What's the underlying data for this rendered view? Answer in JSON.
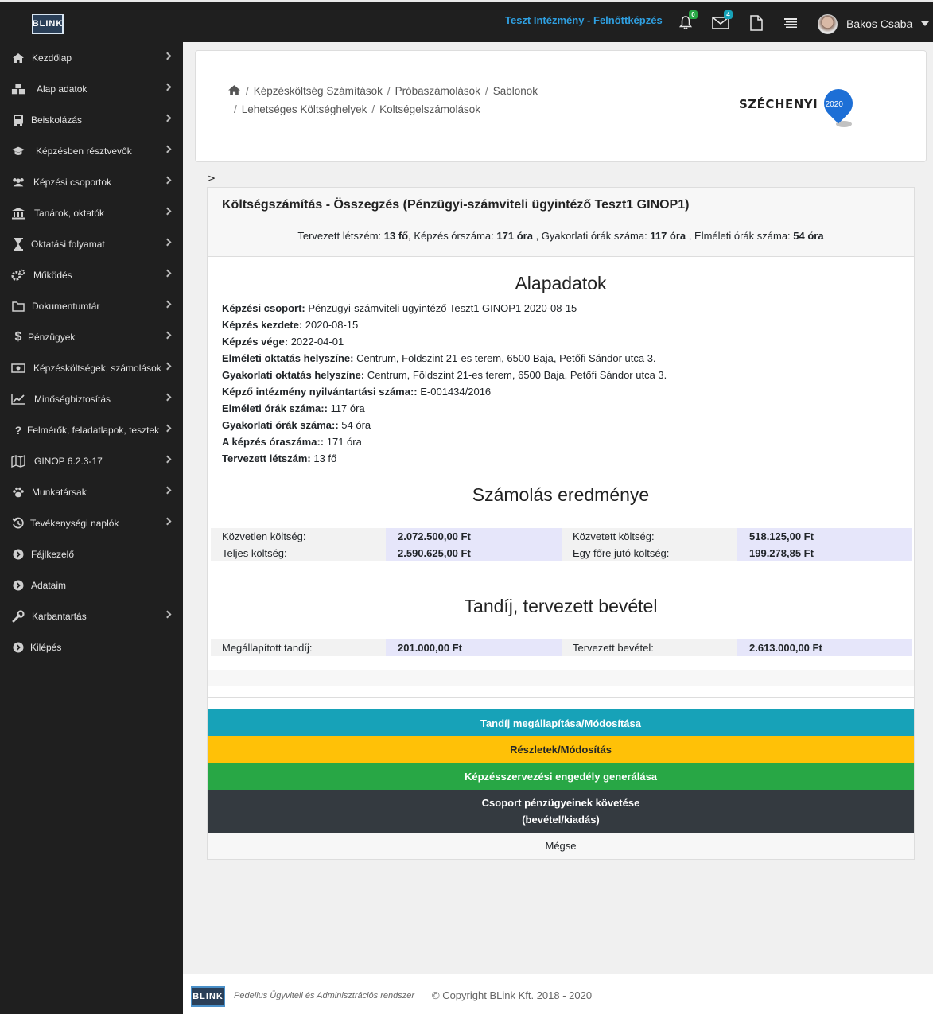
{
  "topbar": {
    "logo": "BLINK",
    "institution": "Teszt Intézmény - Felnőttképzés",
    "notifications_count": "0",
    "messages_count": "4",
    "user_name": "Bakos Csaba"
  },
  "sidebar": {
    "items": [
      {
        "label": "Kezdőlap",
        "icon": "home-icon"
      },
      {
        "label": "Alap adatok",
        "icon": "cubes-icon"
      },
      {
        "label": "Beiskolázás",
        "icon": "bus-icon"
      },
      {
        "label": "Képzésben résztvevők",
        "icon": "graduation-cap-icon"
      },
      {
        "label": "Képzési csoportok",
        "icon": "users-icon"
      },
      {
        "label": "Tanárok, oktatók",
        "icon": "institution-icon"
      },
      {
        "label": "Oktatási folyamat",
        "icon": "hourglass-icon"
      },
      {
        "label": "Működés",
        "icon": "gears-icon"
      },
      {
        "label": "Dokumentumtár",
        "icon": "folder-icon"
      },
      {
        "label": "Pénzügyek",
        "icon": "dollar-icon"
      },
      {
        "label": "Képzésköltségek, számolások",
        "icon": "money-icon"
      },
      {
        "label": "Minőségbiztosítás",
        "icon": "line-chart-icon"
      },
      {
        "label": "Felmérők, feladatlapok, tesztek",
        "icon": "question-icon"
      },
      {
        "label": "GINOP 6.2.3-17",
        "icon": "map-icon"
      },
      {
        "label": "Munkatársak",
        "icon": "paw-icon"
      },
      {
        "label": "Tevékenységi naplók",
        "icon": "history-icon"
      },
      {
        "label": "Fájlkezelő",
        "icon": "circle-arrow-icon"
      },
      {
        "label": "Adataim",
        "icon": "circle-arrow-icon"
      },
      {
        "label": "Karbantartás",
        "icon": "wrench-icon"
      },
      {
        "label": "Kilépés",
        "icon": "circle-arrow-icon"
      }
    ]
  },
  "breadcrumb": {
    "items": [
      "Képzésköltség Számítások",
      "Próbaszámolások",
      "Sablonok",
      "Lehetséges Költséghelyek",
      "Koltségelszámolások"
    ],
    "partner_logo_text": "SZÉCHENYI",
    "partner_logo_badge": "2020"
  },
  "gt_marker": ">",
  "card": {
    "title": "Költségszámítás - Összegzés (Pénzügyi-számviteli ügyintéző Teszt1 GINOP1)",
    "summary": {
      "planned_label": "Tervezett létszém:",
      "planned_value": "13 fő",
      "hours_label": ", Képzés órszáma:",
      "hours_value": "171 óra",
      "practice_label": ", Gyakorlati órák száma:",
      "practice_value": "117 óra",
      "theory_label": ", Elméleti órák száma:",
      "theory_value": "54 óra"
    },
    "basic_title": "Alapadatok",
    "details": [
      {
        "label": "Képzési csoport:",
        "value": " Pénzügyi-számviteli ügyintéző Teszt1 GINOP1 2020-08-15"
      },
      {
        "label": "Képzés kezdete:",
        "value": " 2020-08-15"
      },
      {
        "label": "Képzés vége:",
        "value": " 2022-04-01"
      },
      {
        "label": "Elméleti oktatás helyszíne:",
        "value": " Centrum, Földszint 21-es terem, 6500 Baja, Petőfi Sándor utca 3."
      },
      {
        "label": "Gyakorlati oktatás helyszíne:",
        "value": " Centrum, Földszint 21-es terem, 6500 Baja, Petőfi Sándor utca 3."
      },
      {
        "label": "Képző intézmény nyilvántartási száma::",
        "value": " E-001434/2016"
      },
      {
        "label": "Elméleti órák száma::",
        "value": " 117 óra"
      },
      {
        "label": "Gyakorlati órák száma::",
        "value": " 54 óra"
      },
      {
        "label": "A képzés óraszáma::",
        "value": " 171 óra"
      },
      {
        "label": "Tervezett létszám:",
        "value": " 13 fő"
      }
    ],
    "result_title": "Számolás eredménye",
    "results": {
      "direct_label": "Közvetlen költség:",
      "direct_value": "2.072.500,00 Ft",
      "indirect_label": "Közvetett költség:",
      "indirect_value": "518.125,00 Ft",
      "total_label": "Teljes költség:",
      "total_value": "2.590.625,00 Ft",
      "per_person_label": "Egy főre jutó költség:",
      "per_person_value": "199.278,85 Ft"
    },
    "tuition_title": "Tandíj, tervezett bevétel",
    "tuition": {
      "fee_label": "Megállapított tandíj:",
      "fee_value": "201.000,00 Ft",
      "income_label": "Tervezett bevétel:",
      "income_value": "2.613.000,00 Ft"
    },
    "buttons": {
      "set_fee": "Tandíj megállapítása/Módosítása",
      "details": "Részletek/Módosítás",
      "generate": "Képzésszervezési engedély generálása",
      "track_line1": "Csoport pénzügyeinek követése",
      "track_line2": "(bevétel/kiadás)",
      "cancel": "Mégse"
    },
    "colors": {
      "set_fee": "#17a2b8",
      "details": "#ffc107",
      "generate": "#28a745",
      "track": "#343a40",
      "value_cell": "#e6e6fa"
    }
  },
  "footer": {
    "logo": "BLINK",
    "system_name": "Pedellus Ügyviteli és Adminisztrációs rendszer",
    "copyright": "© Copyright BLink Kft. 2018 - 2020"
  }
}
